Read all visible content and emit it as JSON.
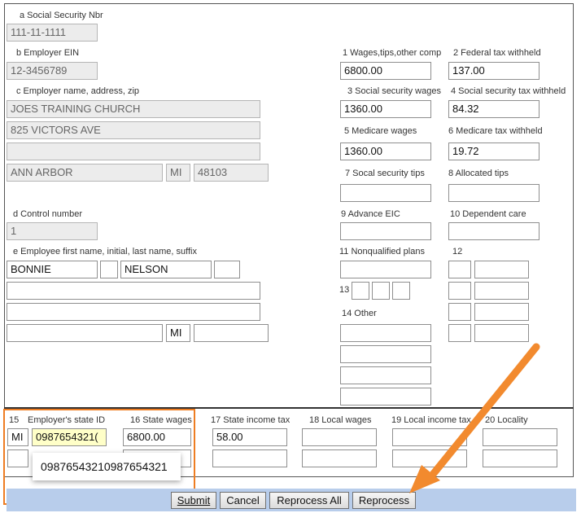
{
  "form": {
    "a_label": "a Social Security Nbr",
    "a_value": "111-11-1111",
    "b_label": "b Employer EIN",
    "b_value": "12-3456789",
    "c_label": "c Employer name, address, zip",
    "c_name": "JOES TRAINING CHURCH",
    "c_addr1": "825 VICTORS AVE",
    "c_addr2": "",
    "c_city": "ANN ARBOR",
    "c_state": "MI",
    "c_zip": "48103",
    "d_label": "d Control number",
    "d_value": "1",
    "e_label": "e Employee first name, initial, last name, suffix",
    "e_first": "BONNIE",
    "e_initial": "",
    "e_last": "NELSON",
    "e_suffix": "",
    "e_addr1": "",
    "e_addr2": "",
    "e_city": "",
    "e_state": "MI",
    "e_zip": "",
    "b1_label": "1 Wages,tips,other comp",
    "b1_value": "6800.00",
    "b2_label": "2 Federal tax withheld",
    "b2_value": "137.00",
    "b3_label": "3 Social security wages",
    "b3_value": "1360.00",
    "b4_label": "4 Social security tax withheld",
    "b4_value": "84.32",
    "b5_label": "5 Medicare wages",
    "b5_value": "1360.00",
    "b6_label": "6 Medicare tax withheld",
    "b6_value": "19.72",
    "b7_label": "7 Socal security tips",
    "b8_label": "8 Allocated tips",
    "b9_label": "9 Advance EIC",
    "b10_label": "10 Dependent care",
    "b11_label": "11 Nonqualified plans",
    "b12_label": "12",
    "b13_label": "13",
    "b14_label": "14 Other"
  },
  "state": {
    "b15_label": "15",
    "state_id_label": "Employer's state ID",
    "b16_label": "16 State wages",
    "b17_label": "17 State income tax",
    "b18_label": "18 Local wages",
    "b19_label": "19 Local income tax",
    "b20_label": "20 Locality",
    "row1_state": "MI",
    "row1_state_id": "0987654321(",
    "row1_wages": "6800.00",
    "row1_tax": "58.00",
    "suggestion": "09876543210987654321"
  },
  "buttons": {
    "submit": "Submit",
    "cancel": "Cancel",
    "reprocess_all": "Reprocess All",
    "reprocess": "Reprocess"
  },
  "colors": {
    "highlight": "#ee7d22",
    "arrow": "#f28a2e",
    "button_bar": "#b8cdeb",
    "autofill": "#ffffc8"
  }
}
